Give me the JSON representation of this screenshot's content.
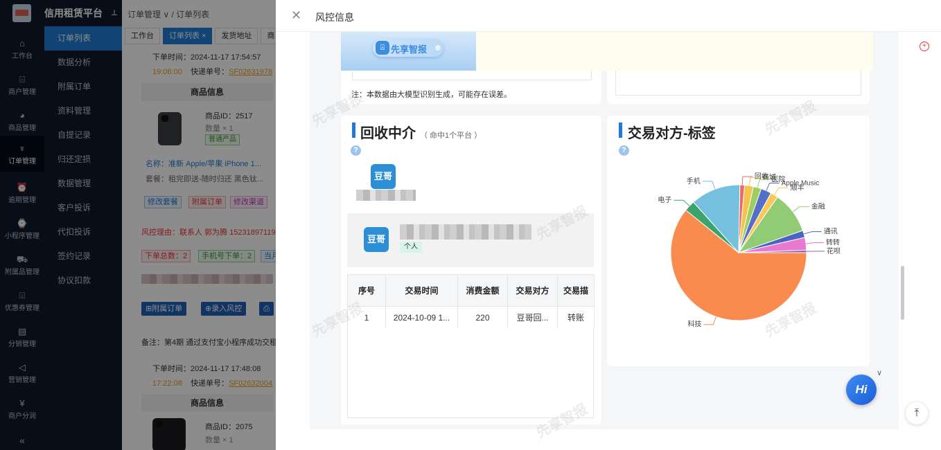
{
  "app": {
    "brand": "信用租赁平台",
    "rail": [
      {
        "label": "工作台",
        "icon": "home-icon"
      },
      {
        "label": "商户管理",
        "icon": "bag-icon"
      },
      {
        "label": "商品管理",
        "icon": "apple-icon"
      },
      {
        "label": "订单管理",
        "icon": "trophy-icon"
      },
      {
        "label": "逾期管理",
        "icon": "alarm-icon"
      },
      {
        "label": "小程序管理",
        "icon": "watch-icon"
      },
      {
        "label": "附属品管理",
        "icon": "cart-icon"
      },
      {
        "label": "优惠券管理",
        "icon": "gift-icon"
      },
      {
        "label": "分销管理",
        "icon": "chart-icon"
      },
      {
        "label": "营销管理",
        "icon": "megaphone-icon"
      },
      {
        "label": "商户分润",
        "icon": "yen-icon"
      }
    ],
    "submenu": [
      "订单列表",
      "数据分析",
      "附属订单",
      "资料管理",
      "自提记录",
      "归还定损",
      "数据管理",
      "客户投诉",
      "代扣投诉",
      "签约记录",
      "协议扣款"
    ]
  },
  "background": {
    "breadcrumb_1": "订单管理",
    "breadcrumb_2": "订单列表",
    "tabs": [
      "工作台",
      "订单列表",
      "发货地址",
      "商"
    ],
    "order1": {
      "order_time": "下单时间：2024-11-17 17:54:57",
      "deadline": "19:06:00",
      "express_label": "快递单号：",
      "express_no": "SF02631978",
      "goods_header": "商品信息",
      "goods_id": "商品ID：2517",
      "qty": "数量 × 1",
      "goods_tag": "普通产品",
      "name": "名称：准新 Apple/苹果 iPhone 1...",
      "package": "套餐：租完即送-随时归还 黑色钛...",
      "btn_modify_pkg": "修改套餐",
      "btn_attached": "附属订单",
      "btn_modify_channel": "修改渠道",
      "risk_reason": "风控理由：联系人 郭为腾 15231897119",
      "tag_total": "下单总数：",
      "tag_total_n": "2",
      "tag_phone": "手机号下单：",
      "tag_phone_n": "2",
      "tag_current": "当月",
      "btn_attached_order": "附属订单",
      "btn_record_risk": "录入风控",
      "remark": "备注：第4期 通过支付宝小程序成功交租"
    },
    "order2": {
      "order_time": "下单时间：2024-11-17 17:48:08",
      "deadline": "17:22:08",
      "express_label": "快递单号：",
      "express_no": "SF02632004",
      "goods_header": "商品信息",
      "goods_id": "商品ID：2075",
      "qty": "数量 × 1"
    }
  },
  "drawer": {
    "title": "风控信息",
    "banner_text": "先享智报",
    "note": "注：本数据由大模型识别生成，可能存在误差。",
    "recycle": {
      "title": "回收中介",
      "subtitle": "（ 命中1个平台 ）",
      "logo_text": "豆哥",
      "party_tag": "个人"
    },
    "table": {
      "headers": [
        "序号",
        "交易时间",
        "消费金额",
        "交易对方",
        "交易描"
      ],
      "rows": [
        [
          "1",
          "2024-10-09 1...",
          "220",
          "豆哥回...",
          "转账"
        ]
      ]
    },
    "counterparty": {
      "title": "交易对方-标签"
    },
    "watermark": "先享智报",
    "hi": "Hi"
  },
  "chart_data": {
    "type": "pie",
    "title": "交易对方-标签",
    "legend": "none",
    "slices": [
      {
        "label": "科技",
        "value": 60.8,
        "color": "#f98b4e"
      },
      {
        "label": "电子",
        "value": 2.6,
        "color": "#3ba36b"
      },
      {
        "label": "手机",
        "value": 11.9,
        "color": "#74c0de"
      },
      {
        "label": "回收",
        "value": 1.1,
        "color": "#ea6b66"
      },
      {
        "label": "商城",
        "value": 2.1,
        "color": "#f4c44f"
      },
      {
        "label": "医院",
        "value": 1.9,
        "color": "#9ccf5f"
      },
      {
        "label": "Apple Music",
        "value": 2.5,
        "color": "#5470c6"
      },
      {
        "label": "顺丰",
        "value": 1.8,
        "color": "#fac858"
      },
      {
        "label": "金融",
        "value": 10.0,
        "color": "#91cc75"
      },
      {
        "label": "通讯",
        "value": 1.7,
        "color": "#4a63c4"
      },
      {
        "label": "转转",
        "value": 3.0,
        "color": "#e878d0"
      },
      {
        "label": "花呗",
        "value": 0.6,
        "color": "#9a60b4"
      }
    ]
  }
}
